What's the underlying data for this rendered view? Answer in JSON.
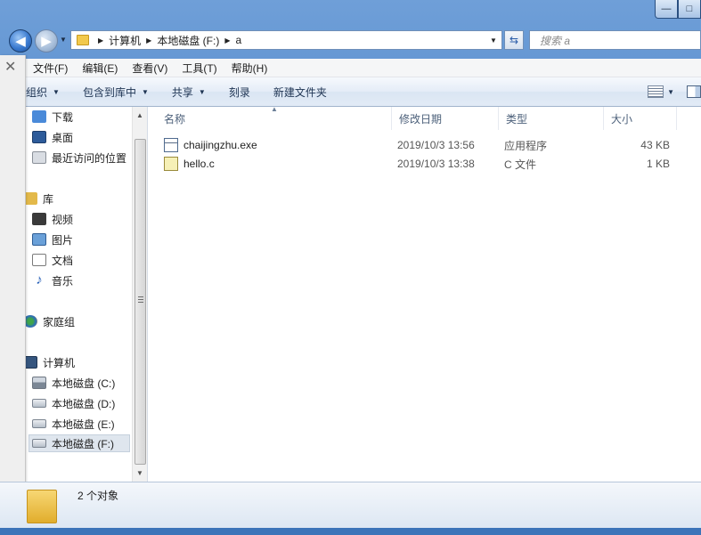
{
  "window": {
    "minimize_glyph": "—",
    "maximize_glyph": "□"
  },
  "address_bar": {
    "breadcrumbs": [
      "计算机",
      "本地磁盘 (F:)",
      "a"
    ],
    "search_placeholder": "搜索 a"
  },
  "menubar": {
    "items": [
      "文件(F)",
      "编辑(E)",
      "查看(V)",
      "工具(T)",
      "帮助(H)"
    ]
  },
  "commandbar": {
    "items": [
      "组织",
      "包含到库中",
      "共享",
      "刻录",
      "新建文件夹"
    ]
  },
  "navpane": {
    "favorites": [
      "下载",
      "桌面",
      "最近访问的位置"
    ],
    "library_title": "库",
    "libraries": [
      "视频",
      "图片",
      "文档",
      "音乐"
    ],
    "homegroup": "家庭组",
    "computer_title": "计算机",
    "drives": [
      "本地磁盘 (C:)",
      "本地磁盘 (D:)",
      "本地磁盘 (E:)",
      "本地磁盘 (F:)"
    ],
    "selected": "本地磁盘 (F:)"
  },
  "content": {
    "columns": [
      "名称",
      "修改日期",
      "类型",
      "大小"
    ],
    "files": [
      {
        "name": "chaijingzhu.exe",
        "modified": "2019/10/3 13:56",
        "type": "应用程序",
        "size": "43 KB",
        "icon": "exe-icon"
      },
      {
        "name": "hello.c",
        "modified": "2019/10/3 13:38",
        "type": "C 文件",
        "size": "1 KB",
        "icon": "c-file-icon"
      }
    ]
  },
  "statusbar": {
    "text": "2 个对象"
  }
}
